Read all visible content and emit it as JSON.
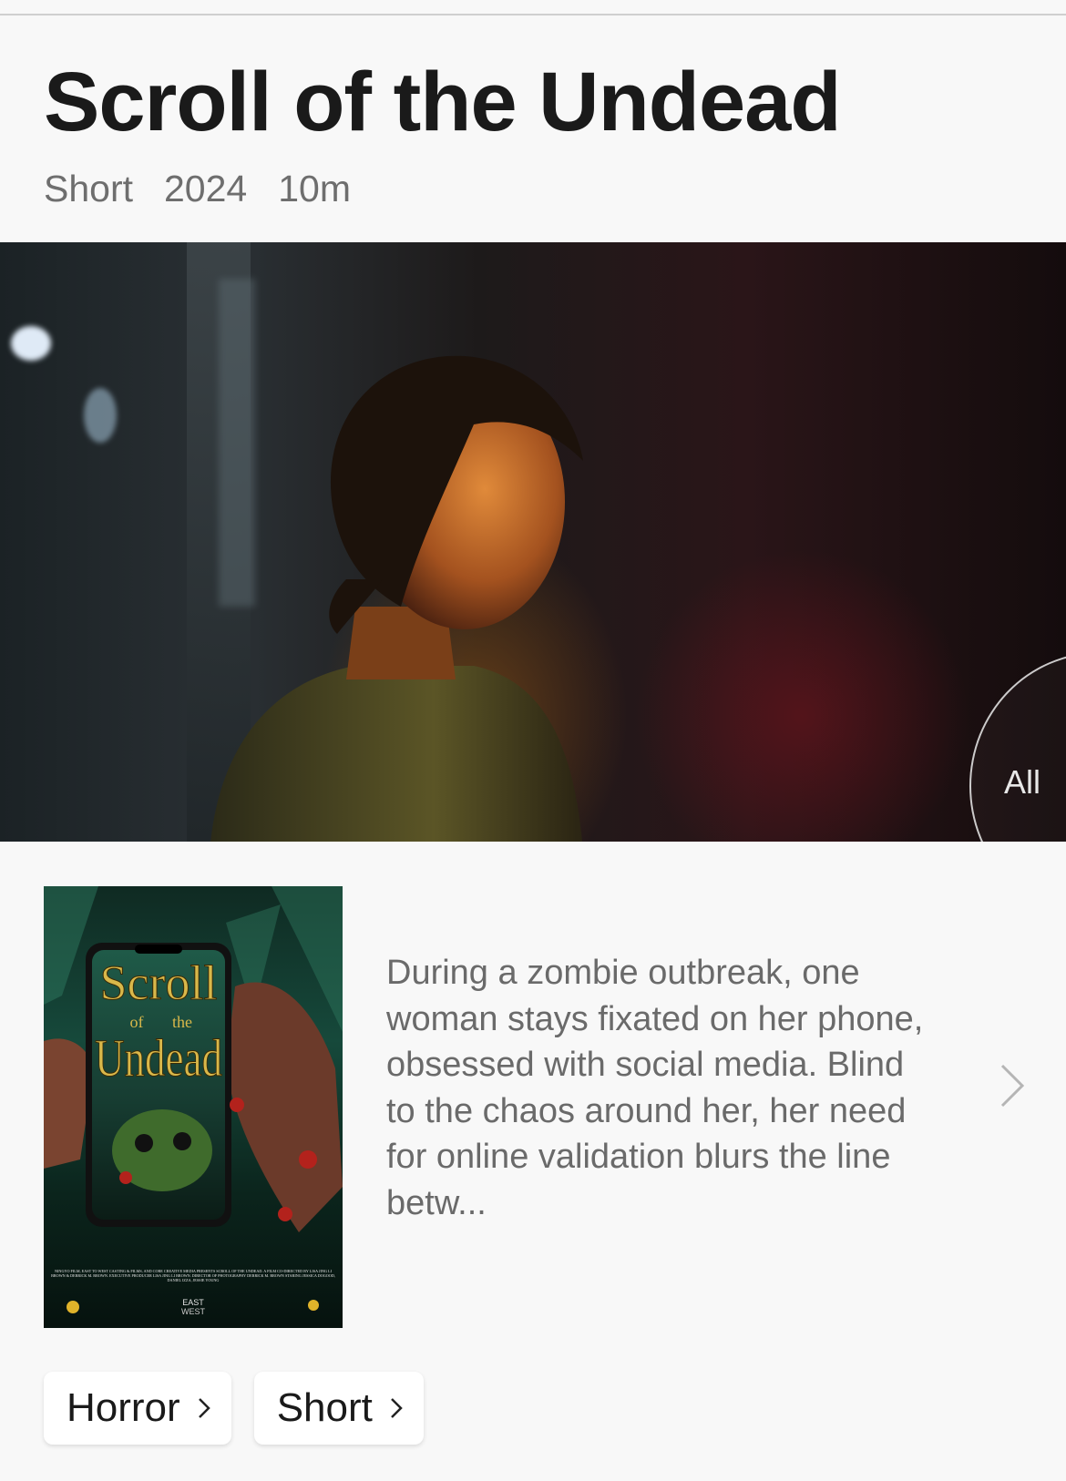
{
  "title": "Scroll of the Undead",
  "meta": {
    "type": "Short",
    "year": "2024",
    "runtime": "10m"
  },
  "gallery": {
    "label": "All"
  },
  "poster": {
    "title_line1": "Scroll",
    "title_small_left": "of",
    "title_small_right": "the",
    "title_line2": "Undead",
    "credits": "NINGYO FILM, EAST TO WEST CASTING & FILMS, AND CORE CREATIVE MEDIA PRESENTS SCROLL OF THE UNDEAD. A FILM CO-DIRECTED BY LISA JING LI BROWN & DERRICK M. BROWN. EXECUTIVE PRODUCER LISA JING LI BROWN. DIRECTOR OF PHOTOGRAPHY DERRICK M. BROWN STARING JESSICA DOGOOD, DANIEL IZZA, JESSIE YOUNG",
    "logo_center_line1": "EAST",
    "logo_center_line2": "WEST"
  },
  "synopsis": "During a zombie outbreak, one woman stays fixated on her phone, obsessed with social media. Blind to the chaos around her, her need for online validation blurs the line betw...",
  "genres": [
    "Horror",
    "Short"
  ],
  "colors": {
    "background": "#f8f8f8",
    "title": "#1a1a1a",
    "meta": "#6e6e6e",
    "poster_title": "#d9b84a"
  }
}
